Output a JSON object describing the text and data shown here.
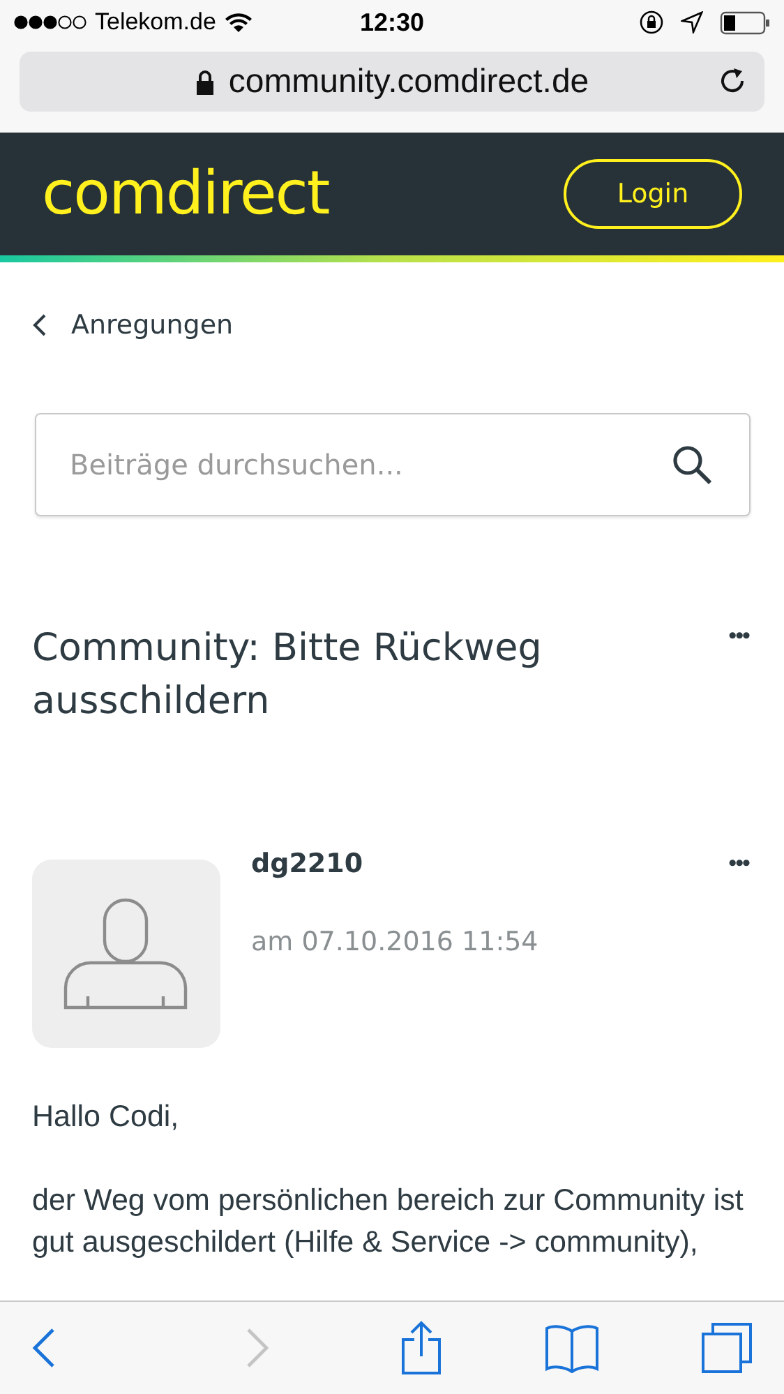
{
  "status_bar": {
    "carrier": "Telekom.de",
    "time": "12:30"
  },
  "address_bar": {
    "url": "community.comdirect.de"
  },
  "header": {
    "logo": "comdirect",
    "login_button": "Login"
  },
  "breadcrumb": {
    "label": "Anregungen"
  },
  "search": {
    "placeholder": "Beiträge durchsuchen..."
  },
  "topic": {
    "title": "Community: Bitte Rückweg ausschildern",
    "menu": "•••"
  },
  "post": {
    "author": "dg2210",
    "date": "am 07.10.2016 11:54",
    "menu": "•••",
    "paragraphs": [
      "Hallo Codi,",
      "der Weg vom persönlichen bereich zur Community ist gut ausgeschildert (Hilfe & Service -> community),"
    ]
  },
  "toolbar": {
    "back_enabled": true,
    "forward_enabled": false
  }
}
